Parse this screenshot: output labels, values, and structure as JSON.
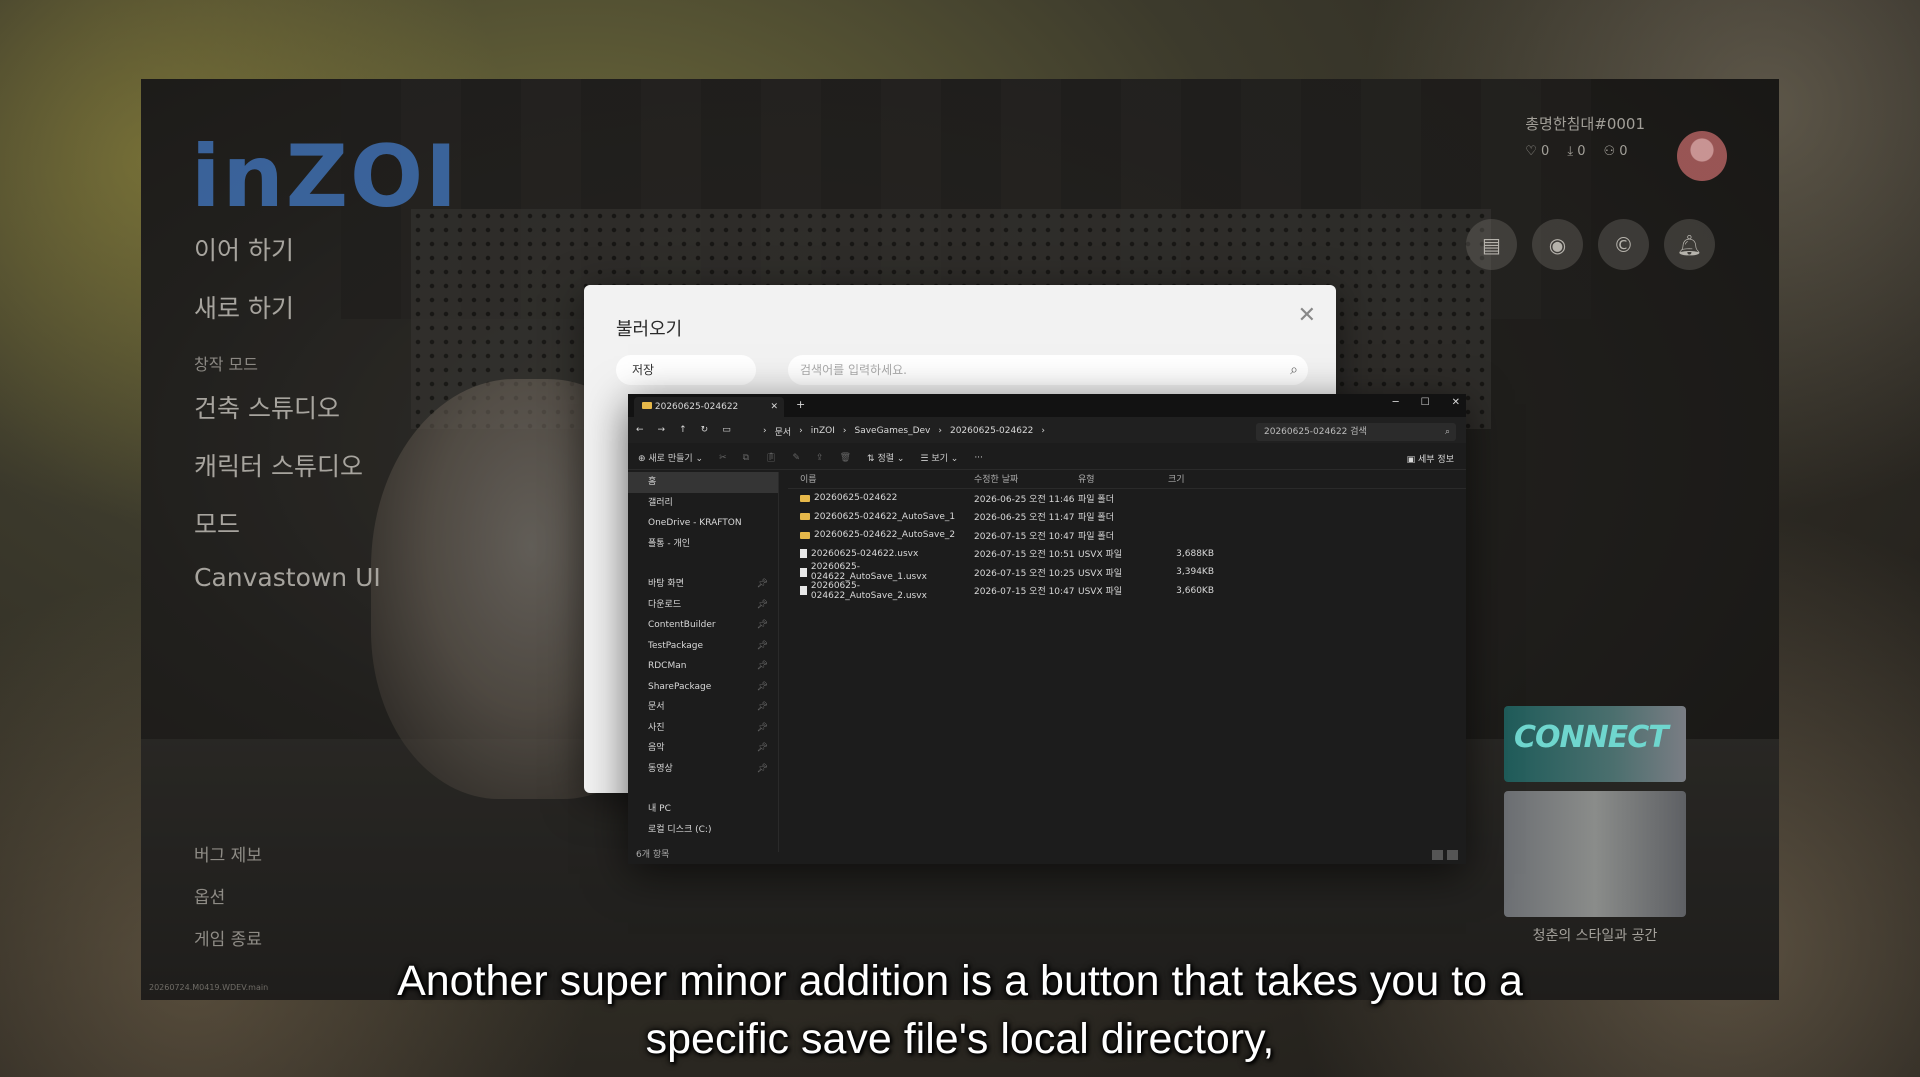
{
  "game": {
    "logo": "inZOI",
    "menu": {
      "continue": "이어 하기",
      "new_game": "새로 하기",
      "create_section": "창작 모드",
      "build_studio": "건축 스튜디오",
      "character_studio": "캐릭터 스튜디오",
      "mods": "모드",
      "canvastown": "Canvastown UI"
    },
    "bottom_menu": {
      "bug_report": "버그 제보",
      "options": "옵션",
      "quit": "게임 종료"
    },
    "build_id": "20260724.M0419.WDEV.main",
    "profile": {
      "name": "총명한침대#0001",
      "likes": "0",
      "downloads": "0",
      "followers": "0"
    },
    "promo": {
      "banner_text": "CONNECT",
      "caption": "청춘의 스타일과 공간"
    }
  },
  "dialog": {
    "title": "불러오기",
    "tab_label": "저장",
    "search_placeholder": "검색어를 입력하세요."
  },
  "explorer": {
    "tab_title": "20260625-024622",
    "path": [
      "문서",
      "inZOI",
      "SaveGames_Dev",
      "20260625-024622"
    ],
    "search_placeholder": "20260625-024622 검색",
    "toolbar": {
      "new": "새로 만들기",
      "sort": "정렬",
      "view": "보기",
      "more": "···",
      "details": "세부 정보"
    },
    "sidebar": [
      {
        "label": "홈",
        "selected": true,
        "pin": false
      },
      {
        "label": "갤러리",
        "selected": false,
        "pin": false
      },
      {
        "label": "OneDrive - KRAFTON",
        "selected": false,
        "pin": false
      },
      {
        "label": "폴통 - 개인",
        "selected": false,
        "pin": false
      },
      {
        "label": "바탕 화면",
        "selected": false,
        "pin": true
      },
      {
        "label": "다운로드",
        "selected": false,
        "pin": true
      },
      {
        "label": "ContentBuilder",
        "selected": false,
        "pin": true
      },
      {
        "label": "TestPackage",
        "selected": false,
        "pin": true
      },
      {
        "label": "RDCMan",
        "selected": false,
        "pin": true
      },
      {
        "label": "SharePackage",
        "selected": false,
        "pin": true
      },
      {
        "label": "문서",
        "selected": false,
        "pin": true
      },
      {
        "label": "사진",
        "selected": false,
        "pin": true
      },
      {
        "label": "음악",
        "selected": false,
        "pin": true
      },
      {
        "label": "동영상",
        "selected": false,
        "pin": true
      },
      {
        "label": "내 PC",
        "selected": false,
        "pin": false
      },
      {
        "label": "로컬 디스크 (C:)",
        "selected": false,
        "pin": false
      }
    ],
    "columns": {
      "name": "이름",
      "date": "수정한 날짜",
      "type": "유형",
      "size": "크기"
    },
    "files": [
      {
        "name": "20260625-024622",
        "date": "2026-06-25 오전 11:46",
        "type": "파일 폴더",
        "size": "",
        "kind": "folder"
      },
      {
        "name": "20260625-024622_AutoSave_1",
        "date": "2026-06-25 오전 11:47",
        "type": "파일 폴더",
        "size": "",
        "kind": "folder"
      },
      {
        "name": "20260625-024622_AutoSave_2",
        "date": "2026-07-15 오전 10:47",
        "type": "파일 폴더",
        "size": "",
        "kind": "folder"
      },
      {
        "name": "20260625-024622.usvx",
        "date": "2026-07-15 오전 10:51",
        "type": "USVX 파일",
        "size": "3,688KB",
        "kind": "file"
      },
      {
        "name": "20260625-024622_AutoSave_1.usvx",
        "date": "2026-07-15 오전 10:25",
        "type": "USVX 파일",
        "size": "3,394KB",
        "kind": "file"
      },
      {
        "name": "20260625-024622_AutoSave_2.usvx",
        "date": "2026-07-15 오전 10:47",
        "type": "USVX 파일",
        "size": "3,660KB",
        "kind": "file"
      }
    ],
    "status": "6개 항목"
  },
  "subtitle": {
    "line1": "Another super minor addition is a button that takes you to a",
    "line2": "specific save file's local directory,"
  }
}
